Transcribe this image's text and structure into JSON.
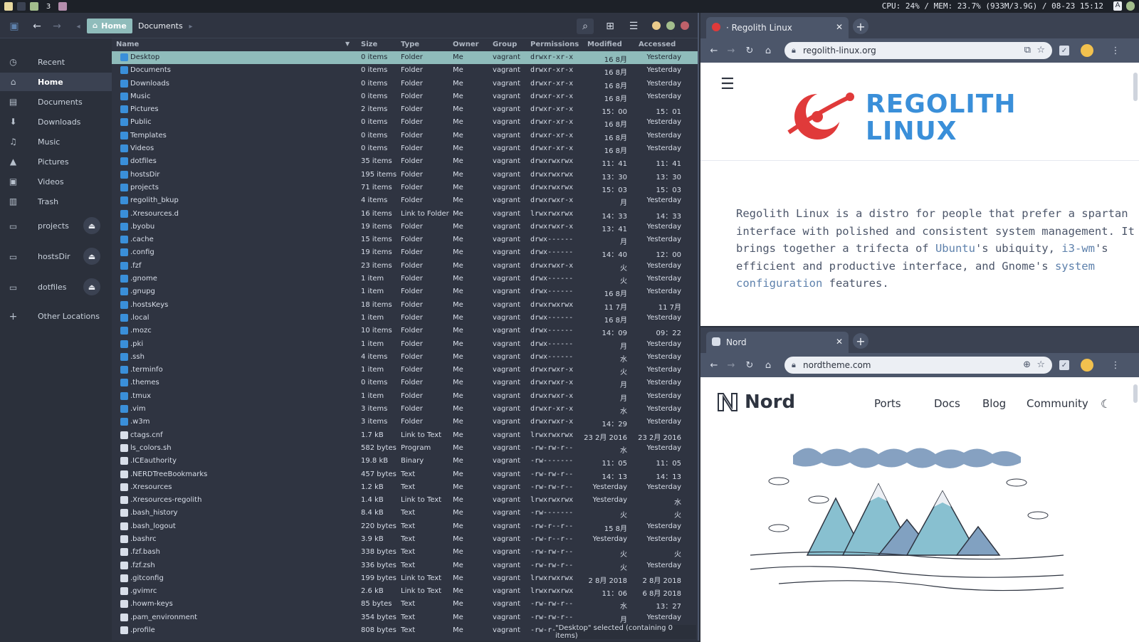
{
  "topbar": {
    "workspace_active": "3",
    "sysinfo": "CPU: 24% / MEM: 23.7% (933M/3.9G) /  08-23  15:12",
    "tray_letter": "A"
  },
  "filemanager": {
    "breadcrumb": {
      "home": "Home",
      "current": "Documents"
    },
    "sidebar": {
      "items": [
        {
          "label": "Recent",
          "icon": "clock-icon"
        },
        {
          "label": "Home",
          "icon": "home-icon"
        },
        {
          "label": "Documents",
          "icon": "document-icon"
        },
        {
          "label": "Downloads",
          "icon": "download-icon"
        },
        {
          "label": "Music",
          "icon": "headphones-icon"
        },
        {
          "label": "Pictures",
          "icon": "image-icon"
        },
        {
          "label": "Videos",
          "icon": "camera-icon"
        },
        {
          "label": "Trash",
          "icon": "trash-icon"
        }
      ],
      "mounts": [
        "projects",
        "hostsDir",
        "dotfiles"
      ],
      "other": "Other Locations"
    },
    "columns": [
      "Name",
      "Size",
      "Type",
      "Owner",
      "Group",
      "Permissions",
      "Modified",
      "Accessed"
    ],
    "rows": [
      [
        "Desktop",
        "0 items",
        "Folder",
        "Me",
        "vagrant",
        "drwxr-xr-x",
        "16 8月",
        "Yesterday",
        "folder"
      ],
      [
        "Documents",
        "0 items",
        "Folder",
        "Me",
        "vagrant",
        "drwxr-xr-x",
        "16 8月",
        "Yesterday",
        "folder"
      ],
      [
        "Downloads",
        "0 items",
        "Folder",
        "Me",
        "vagrant",
        "drwxr-xr-x",
        "16 8月",
        "Yesterday",
        "folder"
      ],
      [
        "Music",
        "0 items",
        "Folder",
        "Me",
        "vagrant",
        "drwxr-xr-x",
        "16 8月",
        "Yesterday",
        "folder"
      ],
      [
        "Pictures",
        "2 items",
        "Folder",
        "Me",
        "vagrant",
        "drwxr-xr-x",
        "15：00",
        "15：01",
        "folder"
      ],
      [
        "Public",
        "0 items",
        "Folder",
        "Me",
        "vagrant",
        "drwxr-xr-x",
        "16 8月",
        "Yesterday",
        "folder"
      ],
      [
        "Templates",
        "0 items",
        "Folder",
        "Me",
        "vagrant",
        "drwxr-xr-x",
        "16 8月",
        "Yesterday",
        "folder"
      ],
      [
        "Videos",
        "0 items",
        "Folder",
        "Me",
        "vagrant",
        "drwxr-xr-x",
        "16 8月",
        "Yesterday",
        "folder"
      ],
      [
        "dotfiles",
        "35 items",
        "Folder",
        "Me",
        "vagrant",
        "drwxrwxrwx",
        "11：41",
        "11：41",
        "folder"
      ],
      [
        "hostsDir",
        "195 items",
        "Folder",
        "Me",
        "vagrant",
        "drwxrwxrwx",
        "13：30",
        "13：30",
        "folder"
      ],
      [
        "projects",
        "71 items",
        "Folder",
        "Me",
        "vagrant",
        "drwxrwxrwx",
        "15：03",
        "15：03",
        "folder"
      ],
      [
        "regolith_bkup",
        "4 items",
        "Folder",
        "Me",
        "vagrant",
        "drwxrwxr-x",
        "月",
        "Yesterday",
        "folder"
      ],
      [
        ".Xresources.d",
        "16 items",
        "Link to Folder",
        "Me",
        "vagrant",
        "lrwxrwxrwx",
        "14：33",
        "14：33",
        "folder"
      ],
      [
        ".byobu",
        "19 items",
        "Folder",
        "Me",
        "vagrant",
        "drwxrwxr-x",
        "13：41",
        "Yesterday",
        "folder"
      ],
      [
        ".cache",
        "15 items",
        "Folder",
        "Me",
        "vagrant",
        "drwx------",
        "月",
        "Yesterday",
        "folder"
      ],
      [
        ".config",
        "19 items",
        "Folder",
        "Me",
        "vagrant",
        "drwx------",
        "14：40",
        "12：00",
        "folder"
      ],
      [
        ".fzf",
        "23 items",
        "Folder",
        "Me",
        "vagrant",
        "drwxrwxr-x",
        "火",
        "Yesterday",
        "folder"
      ],
      [
        ".gnome",
        "1 item",
        "Folder",
        "Me",
        "vagrant",
        "drwx------",
        "火",
        "Yesterday",
        "folder"
      ],
      [
        ".gnupg",
        "1 item",
        "Folder",
        "Me",
        "vagrant",
        "drwx------",
        "16 8月",
        "Yesterday",
        "folder"
      ],
      [
        ".hostsKeys",
        "18 items",
        "Folder",
        "Me",
        "vagrant",
        "drwxrwxrwx",
        "11 7月",
        "11 7月",
        "folder"
      ],
      [
        ".local",
        "1 item",
        "Folder",
        "Me",
        "vagrant",
        "drwx------",
        "16 8月",
        "Yesterday",
        "folder"
      ],
      [
        ".mozc",
        "10 items",
        "Folder",
        "Me",
        "vagrant",
        "drwx------",
        "14：09",
        "09：22",
        "folder"
      ],
      [
        ".pki",
        "1 item",
        "Folder",
        "Me",
        "vagrant",
        "drwx------",
        "月",
        "Yesterday",
        "folder"
      ],
      [
        ".ssh",
        "4 items",
        "Folder",
        "Me",
        "vagrant",
        "drwx------",
        "水",
        "Yesterday",
        "folder"
      ],
      [
        ".terminfo",
        "1 item",
        "Folder",
        "Me",
        "vagrant",
        "drwxrwxr-x",
        "火",
        "Yesterday",
        "folder"
      ],
      [
        ".themes",
        "0 items",
        "Folder",
        "Me",
        "vagrant",
        "drwxrwxr-x",
        "月",
        "Yesterday",
        "folder"
      ],
      [
        ".tmux",
        "1 item",
        "Folder",
        "Me",
        "vagrant",
        "drwxrwxr-x",
        "月",
        "Yesterday",
        "folder"
      ],
      [
        ".vim",
        "3 items",
        "Folder",
        "Me",
        "vagrant",
        "drwxr-xr-x",
        "水",
        "Yesterday",
        "folder"
      ],
      [
        ".w3m",
        "3 items",
        "Folder",
        "Me",
        "vagrant",
        "drwxrwxr-x",
        "14：29",
        "Yesterday",
        "folder"
      ],
      [
        "ctags.cnf",
        "1.7 kB",
        "Link to Text",
        "Me",
        "vagrant",
        "lrwxrwxrwx",
        "23 2月 2016",
        "23 2月 2016",
        "file"
      ],
      [
        "ls_colors.sh",
        "582 bytes",
        "Program",
        "Me",
        "vagrant",
        "-rw-rw-r--",
        "水",
        "Yesterday",
        "file"
      ],
      [
        ".ICEauthority",
        "19.8 kB",
        "Binary",
        "Me",
        "vagrant",
        "-rw-------",
        "11：05",
        "11：05",
        "file"
      ],
      [
        ".NERDTreeBookmarks",
        "457 bytes",
        "Text",
        "Me",
        "vagrant",
        "-rw-rw-r--",
        "14：13",
        "14：13",
        "file"
      ],
      [
        ".Xresources",
        "1.2 kB",
        "Text",
        "Me",
        "vagrant",
        "-rw-rw-r--",
        "Yesterday",
        "Yesterday",
        "file"
      ],
      [
        ".Xresources-regolith",
        "1.4 kB",
        "Link to Text",
        "Me",
        "vagrant",
        "lrwxrwxrwx",
        "Yesterday",
        "水",
        "file"
      ],
      [
        ".bash_history",
        "8.4 kB",
        "Text",
        "Me",
        "vagrant",
        "-rw-------",
        "火",
        "火",
        "file"
      ],
      [
        ".bash_logout",
        "220 bytes",
        "Text",
        "Me",
        "vagrant",
        "-rw-r--r--",
        "15 8月",
        "Yesterday",
        "file"
      ],
      [
        ".bashrc",
        "3.9 kB",
        "Text",
        "Me",
        "vagrant",
        "-rw-r--r--",
        "Yesterday",
        "Yesterday",
        "file"
      ],
      [
        ".fzf.bash",
        "338 bytes",
        "Text",
        "Me",
        "vagrant",
        "-rw-rw-r--",
        "火",
        "火",
        "file"
      ],
      [
        ".fzf.zsh",
        "336 bytes",
        "Text",
        "Me",
        "vagrant",
        "-rw-rw-r--",
        "火",
        "Yesterday",
        "file"
      ],
      [
        ".gitconfig",
        "199 bytes",
        "Link to Text",
        "Me",
        "vagrant",
        "lrwxrwxrwx",
        "2 8月 2018",
        "2 8月 2018",
        "file"
      ],
      [
        ".gvimrc",
        "2.6 kB",
        "Link to Text",
        "Me",
        "vagrant",
        "lrwxrwxrwx",
        "11：06",
        "6 8月 2018",
        "file"
      ],
      [
        ".howm-keys",
        "85 bytes",
        "Text",
        "Me",
        "vagrant",
        "-rw-rw-r--",
        "水",
        "13：27",
        "file"
      ],
      [
        ".pam_environment",
        "354 bytes",
        "Text",
        "Me",
        "vagrant",
        "-rw-rw-r--",
        "月",
        "Yesterday",
        "file"
      ],
      [
        ".profile",
        "808 bytes",
        "Text",
        "Me",
        "vagrant",
        "-rw-r--r--",
        "",
        "",
        "file"
      ]
    ],
    "status": "\"Desktop\" selected (containing 0 items)"
  },
  "browser_top": {
    "tab_title": "· Regolith Linux",
    "url": "regolith-linux.org",
    "logo_line1": "REGOLITH",
    "logo_line2": "LINUX",
    "para_1": "Regolith Linux is a distro for people that prefer a spartan interface with polished and consistent system management. It brings together a trifecta of ",
    "link_ubuntu": "Ubuntu",
    "para_2": "'s ubiquity, ",
    "link_i3": "i3-wm",
    "para_3": "'s efficient and productive interface, and Gnome's ",
    "link_sys": "system configuration",
    "para_4": " features."
  },
  "browser_bottom": {
    "tab_title": "Nord",
    "url": "nordtheme.com",
    "logo": "Nord",
    "nav": [
      "Ports",
      "Docs",
      "Blog",
      "Community"
    ]
  },
  "colors": {
    "nord_blue": "#3a8fd9",
    "selection": "#8fbcbb",
    "regolith_red": "#e03a3a"
  }
}
